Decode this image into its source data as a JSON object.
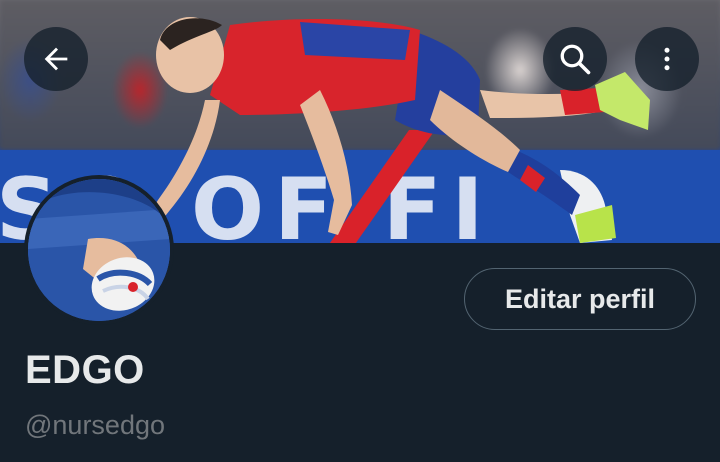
{
  "header": {
    "back_icon": "arrow-left-icon",
    "search_icon": "search-icon",
    "more_icon": "more-vertical-icon"
  },
  "banner": {
    "board_text": "SO OF FI"
  },
  "profile": {
    "display_name": "EDGO",
    "handle": "@nursedgo",
    "edit_label": "Editar perfil"
  },
  "colors": {
    "background": "#15202b",
    "text_primary": "#e7e9ea",
    "text_secondary": "#71767b",
    "button_border": "#536471"
  }
}
